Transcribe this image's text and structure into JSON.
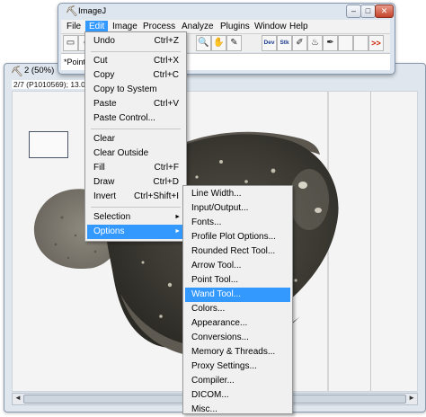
{
  "image_window": {
    "title": "2 (50%)",
    "info": "2/7 (P1010569); 13.03...MB",
    "scroll_left": "◄",
    "scroll_right": "►"
  },
  "imagej": {
    "title": "ImageJ",
    "controls": {
      "minimize": "–",
      "maximize": "□",
      "close": "✕"
    },
    "menus": [
      "File",
      "Edit",
      "Image",
      "Process",
      "Analyze",
      "Plugins",
      "Window",
      "Help"
    ],
    "active_menu": "Edit",
    "tools": [
      {
        "name": "rectangle-tool-icon",
        "glyph": "▭"
      },
      {
        "name": "oval-tool-icon",
        "glyph": "○"
      },
      {
        "name": "magnifier-tool-icon",
        "glyph": "🔍"
      },
      {
        "name": "hand-tool-icon",
        "glyph": "✋"
      },
      {
        "name": "color-picker-tool-icon",
        "glyph": "✎"
      },
      {
        "name": "dev-tool-icon",
        "glyph": "Dev"
      },
      {
        "name": "stacks-tool-icon",
        "glyph": "Stk"
      },
      {
        "name": "brush-tool-icon",
        "glyph": "✐"
      },
      {
        "name": "flood-fill-tool-icon",
        "glyph": "♨"
      },
      {
        "name": "dropper-tool-icon",
        "glyph": "✒"
      },
      {
        "name": "more-tools-icon",
        "glyph": ">>"
      }
    ],
    "status": "*Point*           (click to switch)"
  },
  "edit_menu": {
    "items": [
      {
        "label": "Undo",
        "shortcut": "Ctrl+Z"
      },
      {
        "label": "Cut",
        "shortcut": "Ctrl+X"
      },
      {
        "label": "Copy",
        "shortcut": "Ctrl+C"
      },
      {
        "label": "Copy to System",
        "shortcut": ""
      },
      {
        "label": "Paste",
        "shortcut": "Ctrl+V"
      },
      {
        "label": "Paste Control...",
        "shortcut": ""
      },
      {
        "label": "Clear",
        "shortcut": ""
      },
      {
        "label": "Clear Outside",
        "shortcut": ""
      },
      {
        "label": "Fill",
        "shortcut": "Ctrl+F"
      },
      {
        "label": "Draw",
        "shortcut": "Ctrl+D"
      },
      {
        "label": "Invert",
        "shortcut": "Ctrl+Shift+I"
      },
      {
        "label": "Selection",
        "shortcut": ""
      },
      {
        "label": "Options",
        "shortcut": ""
      }
    ],
    "submenu_arrow": "►"
  },
  "options_menu": {
    "items": [
      "Line Width...",
      "Input/Output...",
      "Fonts...",
      "Profile Plot Options...",
      "Rounded Rect Tool...",
      "Arrow Tool...",
      "Point Tool...",
      "Wand Tool...",
      "Colors...",
      "Appearance...",
      "Conversions...",
      "Memory & Threads...",
      "Proxy Settings...",
      "Compiler...",
      "DICOM...",
      "Misc..."
    ],
    "highlighted": "Wand Tool..."
  }
}
